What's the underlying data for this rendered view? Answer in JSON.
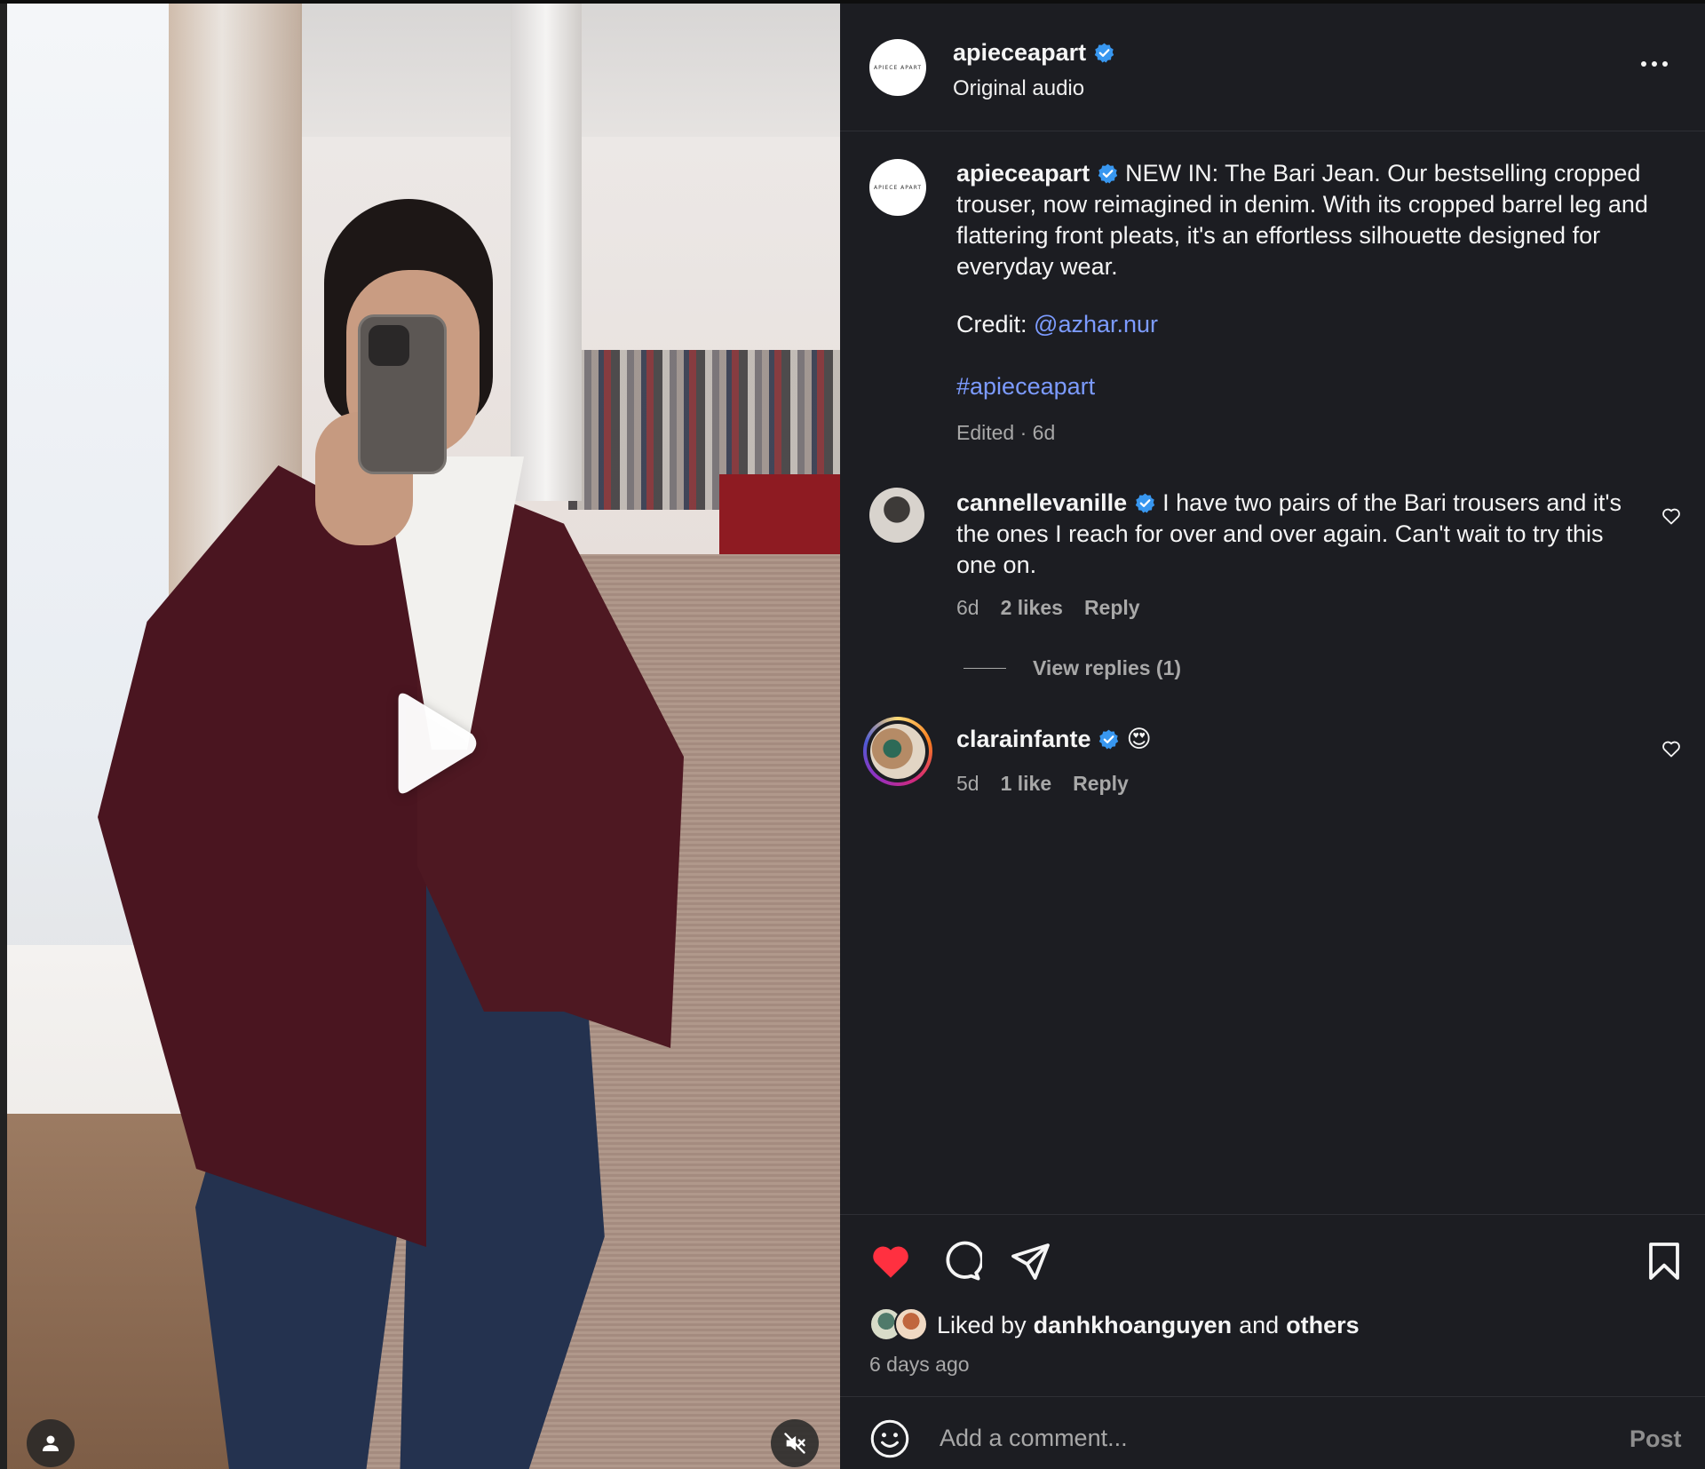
{
  "post": {
    "author": "apieceapart",
    "avatar_text": "APIECE APART",
    "audio": "Original audio",
    "more_icon": "more-horizontal-icon"
  },
  "caption": {
    "author": "apieceapart",
    "text": "NEW IN: The Bari Jean. Our bestselling cropped trouser, now reimagined in denim. With its cropped barrel leg and flattering front pleats, it's an effortless silhouette designed for everyday wear.",
    "credit_label": "Credit:",
    "credit_handle": "@azhar.nur",
    "hashtag": "#apieceapart",
    "meta": "Edited · 6d"
  },
  "comments": [
    {
      "author": "cannellevanille",
      "text": "I have two pairs of the Bari trousers and it's the ones I reach for over and over again. Can't wait to try this one on.",
      "time": "6d",
      "likes": "2 likes",
      "reply": "Reply",
      "view_replies": "View replies (1)"
    },
    {
      "author": "clarainfante",
      "text": "😍",
      "time": "5d",
      "likes": "1 like",
      "reply": "Reply"
    }
  ],
  "actions": {
    "liked_by_prefix": "Liked by",
    "liked_by_user": "danhkhoanguyen",
    "liked_by_and": "and",
    "liked_by_others": "others",
    "timestamp": "6 days ago"
  },
  "composer": {
    "placeholder": "Add a comment...",
    "post_label": "Post"
  },
  "colors": {
    "background": "#1c1d22",
    "link": "#7c9bff",
    "verified": "#3897f0",
    "liked_heart": "#ff3040",
    "muted_text": "#a8a8a8"
  }
}
